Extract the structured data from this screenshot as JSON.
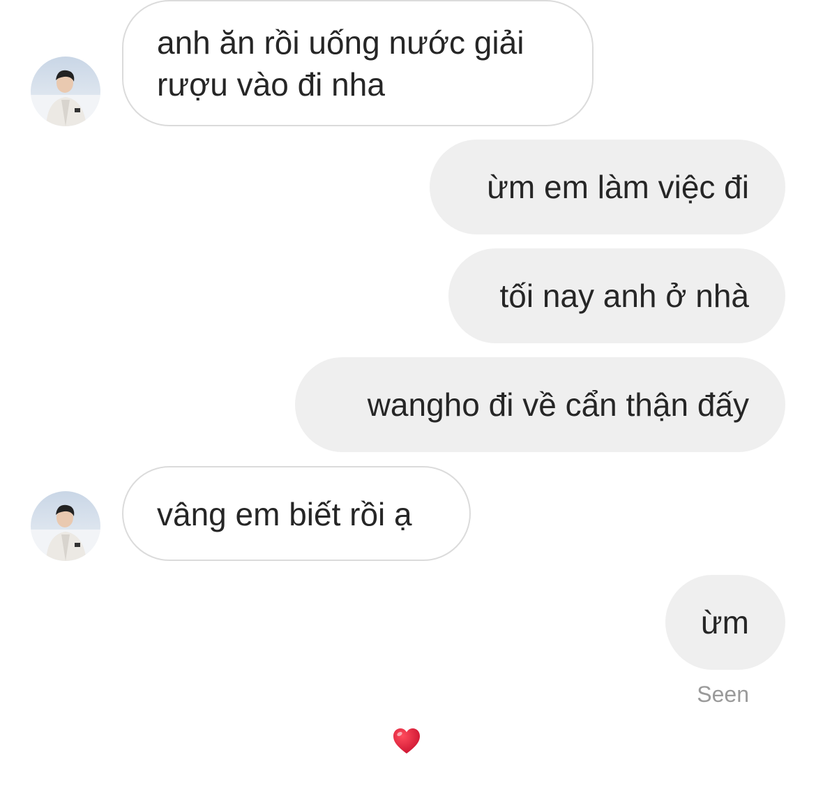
{
  "thread": {
    "messages": [
      {
        "sender": "other",
        "text_line1": "anh ăn rồi uống nước giải",
        "text_line2": "rượu vào đi nha"
      },
      {
        "sender": "me",
        "text": "ừm em làm việc đi"
      },
      {
        "sender": "me",
        "text": "tối nay anh ở nhà"
      },
      {
        "sender": "me",
        "text": "wangho đi về cẩn thận đấy"
      },
      {
        "sender": "other",
        "text": "vâng em biết rồi ạ"
      },
      {
        "sender": "me",
        "text": "ừm"
      }
    ],
    "status": "Seen",
    "reaction_icon": "red-heart-icon"
  },
  "colors": {
    "outgoing_bubble": "#efefef",
    "incoming_border": "#dbdbdb",
    "text": "#262626",
    "seen_text": "#9a9a9a",
    "heart": "#e0162b"
  }
}
